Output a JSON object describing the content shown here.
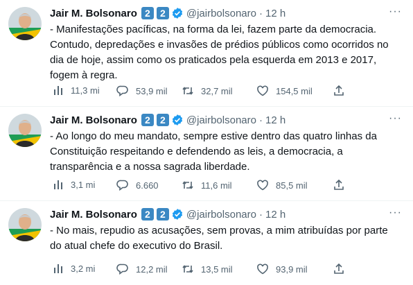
{
  "colors": {
    "badge_blue": "#3b88c3",
    "verified_blue": "#1d9bf0",
    "secondary_text": "#536471"
  },
  "icons": [
    "views-icon",
    "reply-icon",
    "retweet-icon",
    "like-icon",
    "share-icon",
    "more-icon",
    "verified-icon"
  ],
  "tweets": [
    {
      "author": "Jair M. Bolsonaro",
      "badge1": "2",
      "badge2": "2",
      "handle": "@jairbolsonaro",
      "dot": "·",
      "time": "12 h",
      "more": "···",
      "text": "- Manifestações pacíficas, na forma da lei, fazem parte da democracia. Contudo, depredações e invasões de prédios públicos como ocorridos no dia de hoje, assim como os praticados pela esquerda em 2013 e 2017, fogem à regra.",
      "views": "11,3 mi",
      "replies": "53,9 mil",
      "retweets": "32,7 mil",
      "likes": "154,5 mil"
    },
    {
      "author": "Jair M. Bolsonaro",
      "badge1": "2",
      "badge2": "2",
      "handle": "@jairbolsonaro",
      "dot": "·",
      "time": "12 h",
      "more": "···",
      "text": "- Ao longo do meu mandato, sempre estive dentro das quatro linhas da Constituição respeitando e defendendo as leis, a democracia, a transparência e a nossa sagrada liberdade.",
      "views": "3,1 mi",
      "replies": "6.660",
      "retweets": "11,6 mil",
      "likes": "85,5 mil"
    },
    {
      "author": "Jair M. Bolsonaro",
      "badge1": "2",
      "badge2": "2",
      "handle": "@jairbolsonaro",
      "dot": "·",
      "time": "12 h",
      "more": "···",
      "text": "- No mais, repudio as acusações, sem provas, a mim atribuídas por parte do atual chefe do executivo do Brasil.",
      "views": "3,2 mi",
      "replies": "12,2 mil",
      "retweets": "13,5 mil",
      "likes": "93,9 mil"
    }
  ]
}
